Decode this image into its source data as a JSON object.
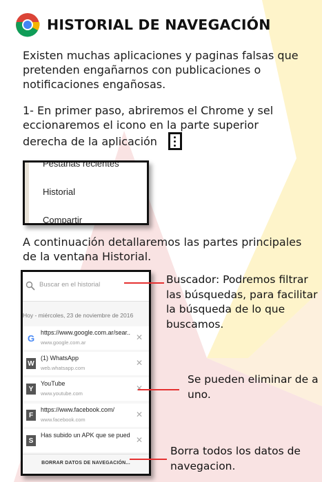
{
  "title": "HISTORIAL DE NAVEGACIÓN",
  "intro": "Existen muchas aplicaciones y paginas falsas que pretenden engañarnos con publicaciones o notificaciones engañosas.",
  "step1": {
    "line1": "1-  En primer paso, abriremos el Chrome y sel",
    "line2": "eccionaremos el icono en la parte superior",
    "line3": "derecha de la aplicación"
  },
  "menu_screenshot": {
    "items": [
      "Pestañas recientes",
      "Historial",
      "Compartir"
    ]
  },
  "continuation": "A continuación detallaremos las partes principales de la ventana Historial.",
  "history_screenshot": {
    "search_placeholder": "Buscar en el historial",
    "date_header": "Hoy - miércoles, 23 de noviembre de 2016",
    "rows": [
      {
        "icon": "G",
        "title": "https://www.google.com.ar/sear...",
        "url": "www.google.com.ar"
      },
      {
        "icon": "W",
        "title": "(1) WhatsApp",
        "url": "web.whatsapp.com"
      },
      {
        "icon": "Y",
        "title": "YouTube",
        "url": "www.youtube.com"
      },
      {
        "icon": "F",
        "title": "https://www.facebook.com/",
        "url": "www.facebook.com"
      },
      {
        "icon": "S",
        "title": "Has subido un APK que se puede ...",
        "url": ""
      }
    ],
    "clear_button": "BORRAR DATOS DE NAVEGACIÓN..."
  },
  "annotations": {
    "buscador": "Buscador: Podremos filtrar las búsquedas, para facilitar la búsqueda de lo que buscamos.",
    "eliminar": "Se pueden eliminar de a uno.",
    "borra": "Borra todos los datos de navegacion."
  },
  "colors": {
    "pointer_red": "#e53030",
    "bg_pink": "#f7dede",
    "bg_yellow": "#fdf3c0"
  }
}
